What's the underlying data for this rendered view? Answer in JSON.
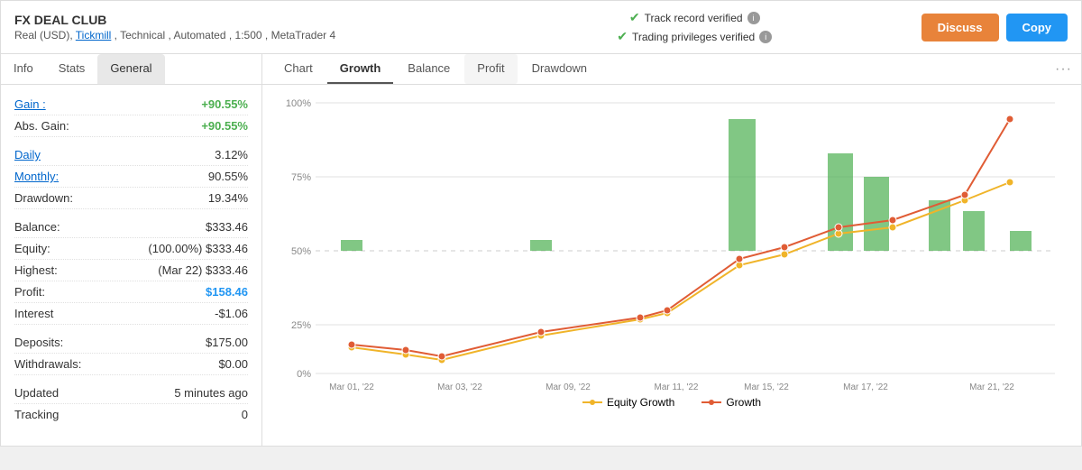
{
  "header": {
    "title": "FX DEAL CLUB",
    "subtitle": "Real (USD), Tickmill , Technical , Automated , 1:500 , MetaTrader 4",
    "badge1": "Track record verified",
    "badge2": "Trading privileges verified",
    "discuss_label": "Discuss",
    "copy_label": "Copy"
  },
  "left_tabs": [
    {
      "label": "Info",
      "active": false
    },
    {
      "label": "Stats",
      "active": false
    },
    {
      "label": "General",
      "active": true
    }
  ],
  "stats": {
    "gain_label": "Gain :",
    "gain_value": "+90.55%",
    "abs_gain_label": "Abs. Gain:",
    "abs_gain_value": "+90.55%",
    "daily_label": "Daily",
    "daily_value": "3.12%",
    "monthly_label": "Monthly:",
    "monthly_value": "90.55%",
    "drawdown_label": "Drawdown:",
    "drawdown_value": "19.34%",
    "balance_label": "Balance:",
    "balance_value": "$333.46",
    "equity_label": "Equity:",
    "equity_value": "(100.00%) $333.46",
    "highest_label": "Highest:",
    "highest_value": "(Mar 22) $333.46",
    "profit_label": "Profit:",
    "profit_value": "$158.46",
    "interest_label": "Interest",
    "interest_value": "-$1.06",
    "deposits_label": "Deposits:",
    "deposits_value": "$175.00",
    "withdrawals_label": "Withdrawals:",
    "withdrawals_value": "$0.00",
    "updated_label": "Updated",
    "updated_value": "5 minutes ago",
    "tracking_label": "Tracking",
    "tracking_value": "0"
  },
  "chart_tabs": [
    {
      "label": "Chart",
      "active": false
    },
    {
      "label": "Growth",
      "active": true
    },
    {
      "label": "Balance",
      "active": false
    },
    {
      "label": "Profit",
      "active": false
    },
    {
      "label": "Drawdown",
      "active": false
    }
  ],
  "chart": {
    "y_labels": [
      "100%",
      "75%",
      "50%",
      "25%",
      "0%"
    ],
    "x_labels": [
      "Mar 01, '22",
      "Mar 03, '22",
      "Mar 09, '22",
      "Mar 11, '22",
      "Mar 15, '22",
      "Mar 17, '22",
      "Mar 21, '22"
    ],
    "legend": [
      {
        "label": "Equity Growth",
        "color": "#f0b429"
      },
      {
        "label": "Growth",
        "color": "#e05c35"
      }
    ]
  }
}
